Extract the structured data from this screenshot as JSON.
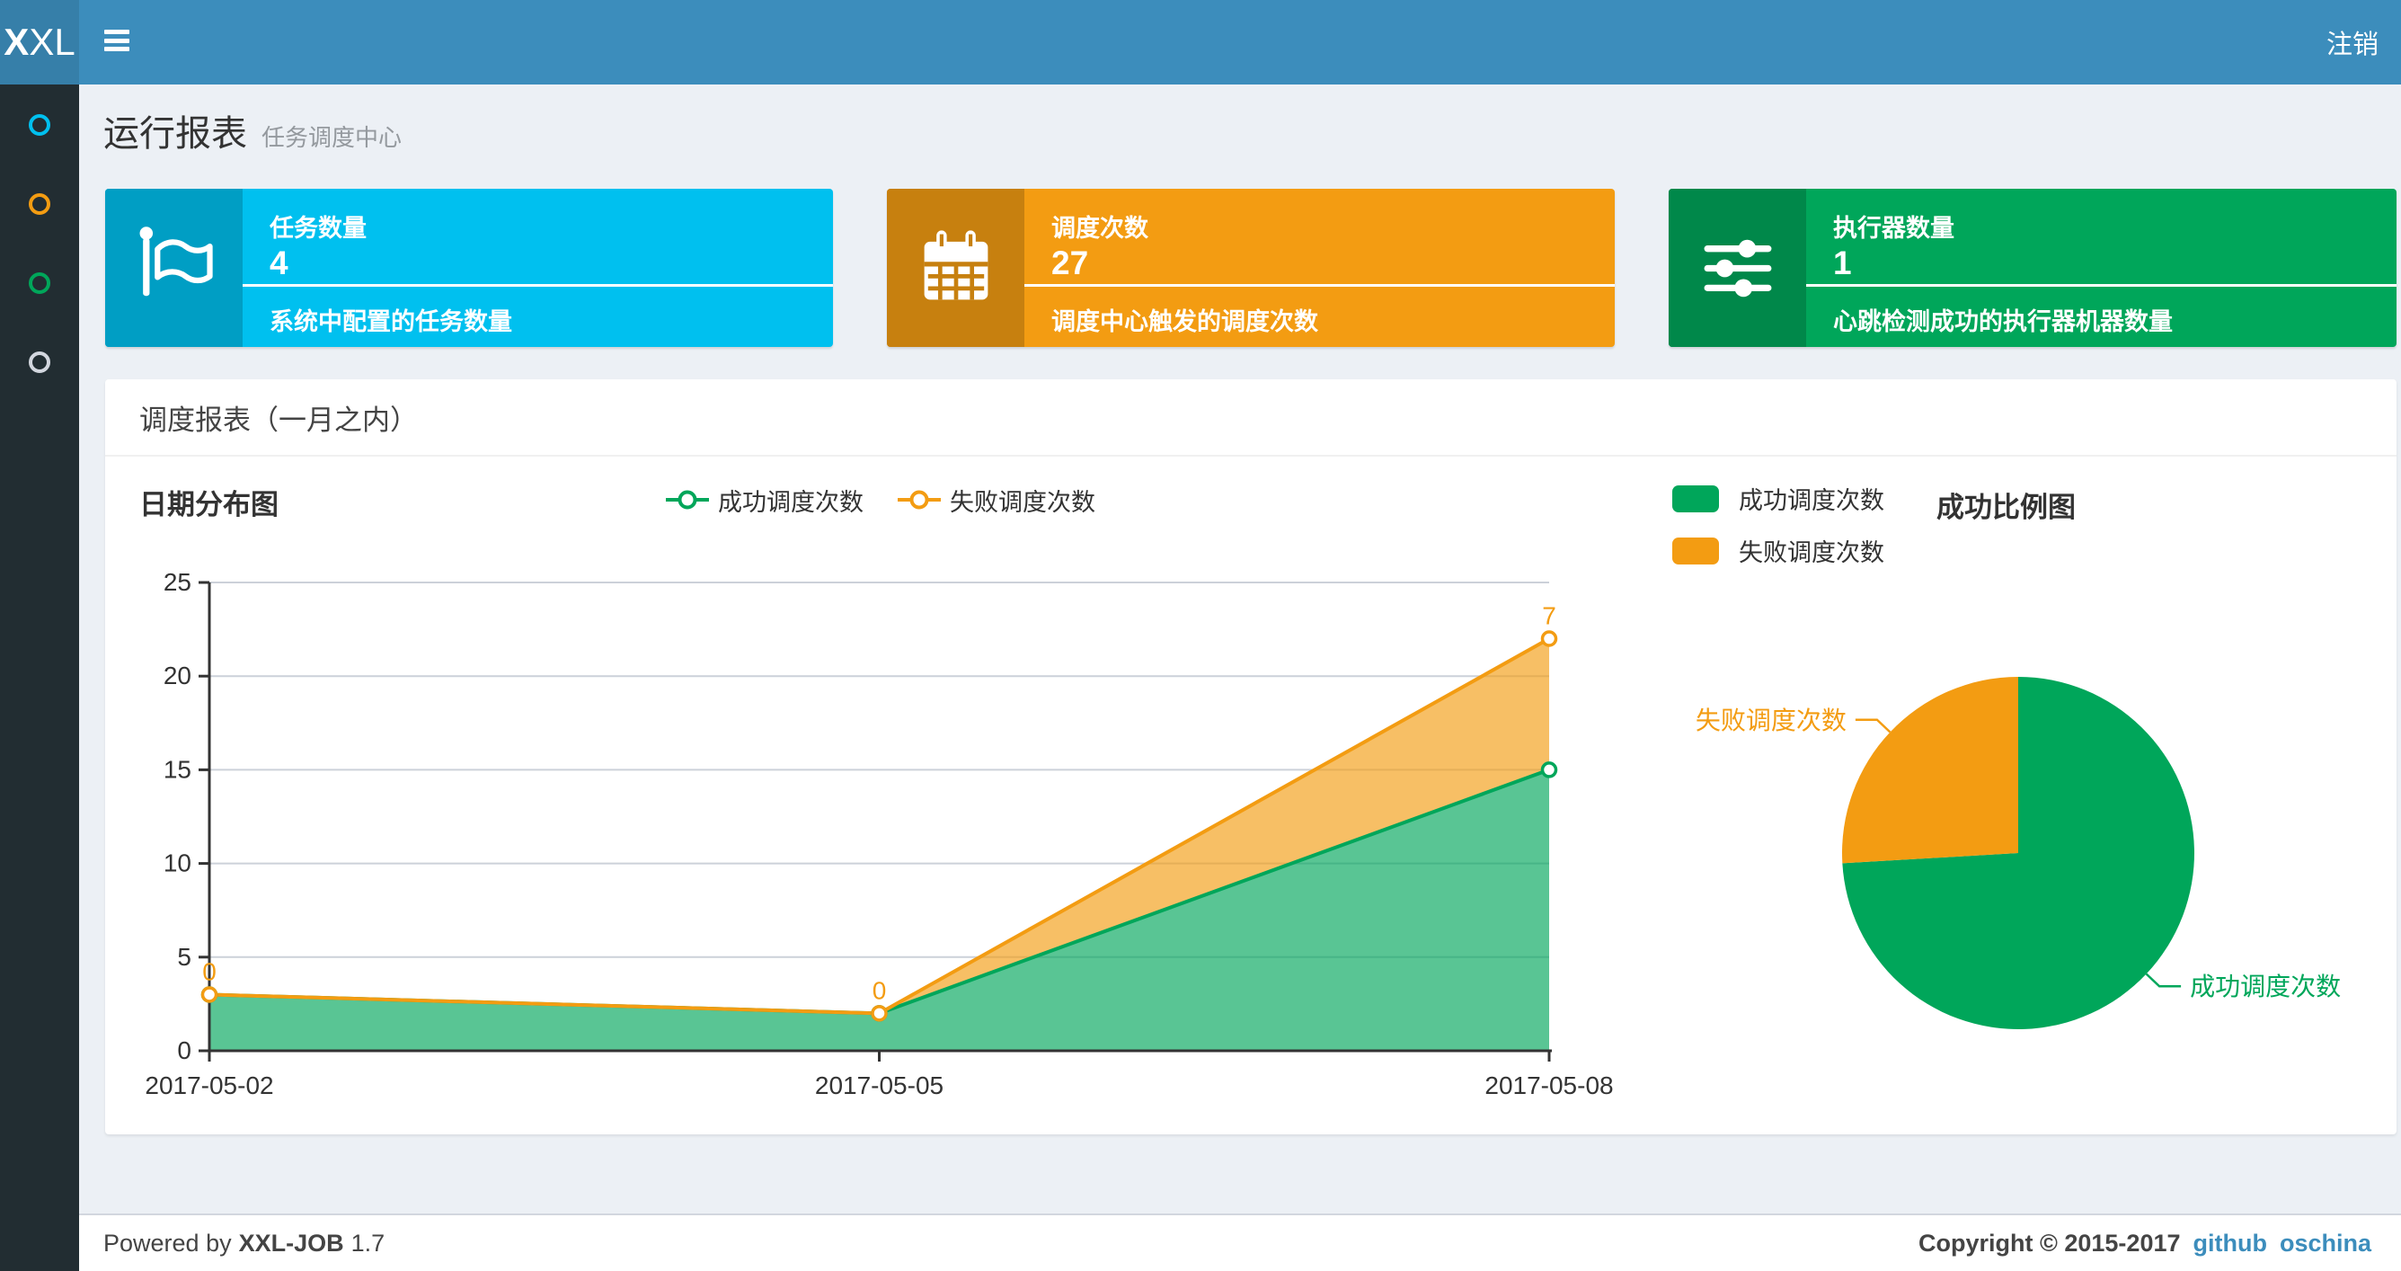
{
  "navbar": {
    "logo_bold": "X",
    "logo_rest": "XL",
    "logout_label": "注销",
    "colors": {
      "navbar_bg": "#3c8dbc",
      "logo_bg": "#367fa9"
    }
  },
  "sidebar": {
    "bg": "#222d32",
    "items": [
      {
        "id": "menu-item-1",
        "icon": "circle-o-icon",
        "color": "#00c0ef"
      },
      {
        "id": "menu-item-2",
        "icon": "circle-o-icon",
        "color": "#f39c12"
      },
      {
        "id": "menu-item-3",
        "icon": "circle-o-icon",
        "color": "#00a65a"
      },
      {
        "id": "menu-item-4",
        "icon": "circle-o-icon",
        "color": "#d2d6de"
      }
    ]
  },
  "page_header": {
    "title": "运行报表",
    "subtitle": "任务调度中心"
  },
  "stat_boxes": [
    {
      "title": "任务数量",
      "value": "4",
      "description": "系统中配置的任务数量",
      "icon": "flag-icon",
      "color": "#00c0ef",
      "icon_bg": "#009ec4"
    },
    {
      "title": "调度次数",
      "value": "27",
      "description": "调度中心触发的调度次数",
      "icon": "calendar-icon",
      "color": "#f39c12",
      "icon_bg": "#c7800f"
    },
    {
      "title": "执行器数量",
      "value": "1",
      "description": "心跳检测成功的执行器机器数量",
      "icon": "sliders-icon",
      "color": "#00a65a",
      "icon_bg": "#00884a"
    }
  ],
  "panel": {
    "title": "调度报表（一月之内）"
  },
  "chart_data": [
    {
      "type": "area",
      "title": "日期分布图",
      "stacked": true,
      "x": [
        "2017-05-02",
        "2017-05-05",
        "2017-05-08"
      ],
      "series": [
        {
          "name": "成功调度次数",
          "color": "#00a65a",
          "values": [
            3,
            2,
            15
          ]
        },
        {
          "name": "失败调度次数",
          "color": "#f39c12",
          "values": [
            0,
            0,
            7
          ],
          "point_labels": [
            "0",
            "0",
            "7"
          ]
        }
      ],
      "ylim": [
        0,
        25
      ],
      "yticks": [
        0,
        5,
        10,
        15,
        20,
        25
      ],
      "grid": true,
      "legend_position": "top-center"
    },
    {
      "type": "pie",
      "title": "成功比例图",
      "slices": [
        {
          "name": "成功调度次数",
          "value": 20,
          "color": "#00a65a"
        },
        {
          "name": "失败调度次数",
          "value": 7,
          "color": "#f39c12"
        }
      ],
      "total": 27,
      "legend_position": "top-left"
    }
  ],
  "footer": {
    "powered_prefix": "Powered by",
    "product": "XXL-JOB",
    "version": "1.7",
    "copyright": "Copyright © 2015-2017",
    "links": [
      "github",
      "oschina"
    ],
    "link_color": "#3c8dbc"
  }
}
